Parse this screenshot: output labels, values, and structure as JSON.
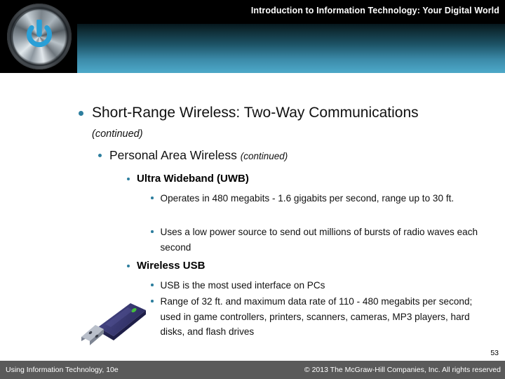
{
  "header": {
    "title": "Introduction to Information Technology: Your Digital World",
    "logo_icon": "power-button-icon",
    "accent_color": "#4aa4c4",
    "bar_color": "#000000"
  },
  "slide": {
    "bullet_color": "#2d7e9e",
    "level1": {
      "text": "Short-Range Wireless: Two-Way Communications",
      "continued": "(continued)"
    },
    "level2": {
      "text": "Personal Area Wireless ",
      "continued": "(continued)"
    },
    "sections": [
      {
        "heading": "Ultra Wideband (UWB)",
        "items": [
          "Operates in 480 megabits - 1.6 gigabits per second, range up to 30 ft.",
          "Uses a low power source to send out millions of bursts of radio waves each second"
        ]
      },
      {
        "heading": "Wireless USB",
        "items": [
          "USB is the most used interface on PCs",
          "Range of 32 ft. and maximum data rate of 110 - 480 megabits per second; used in game controllers, printers, scanners, cameras, MP3 players, hard disks, and flash drives"
        ]
      }
    ],
    "image": {
      "name": "usb-flash-drive-image",
      "body_color": "#2a2a5e",
      "connector_color": "#9aa0b0",
      "led_color": "#44c23a"
    }
  },
  "footer": {
    "page_number": "53",
    "left_text": "Using Information Technology, 10e",
    "right_text": "© 2013 The McGraw-Hill Companies, Inc. All rights reserved",
    "bar_color": "#5a5a5a"
  }
}
